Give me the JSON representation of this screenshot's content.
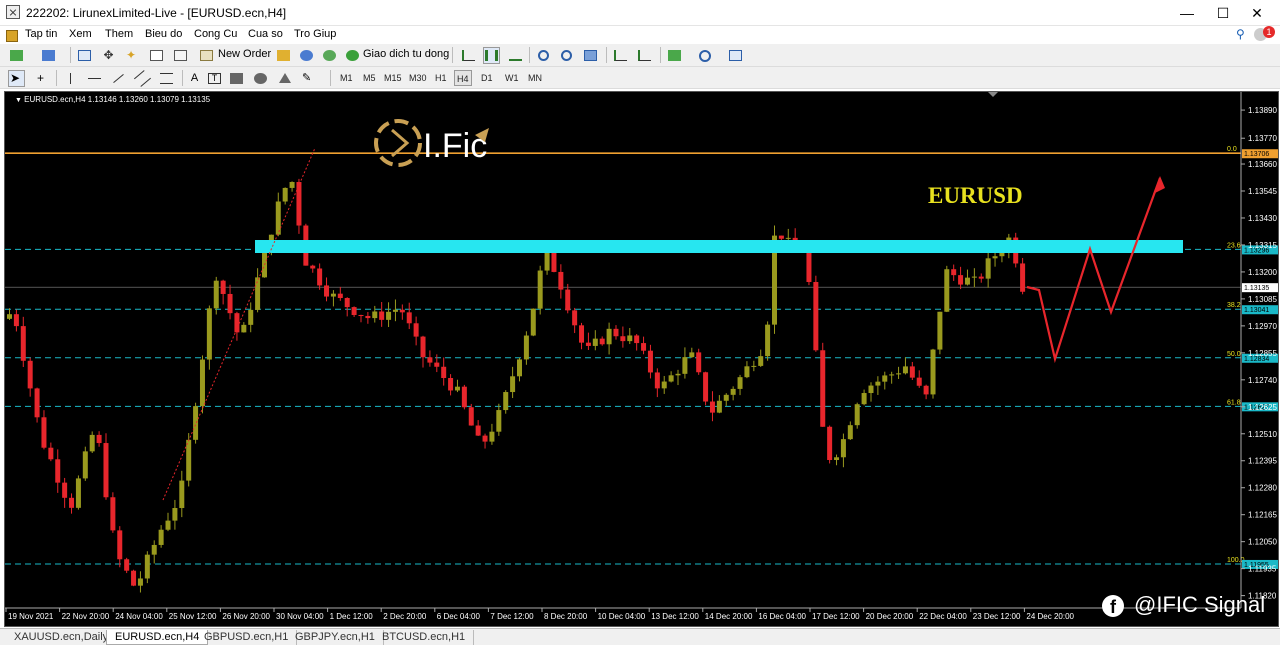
{
  "window": {
    "title": "222202: LirunexLimited-Live - [EURUSD.ecn,H4]",
    "minimize": "—",
    "maximize": "☐",
    "close": "✕"
  },
  "menu": {
    "items": [
      "Tap tin",
      "Xem",
      "Them",
      "Bieu do",
      "Cong Cu",
      "Cua so",
      "Tro Giup"
    ],
    "mdi": [
      "_",
      "🗗",
      "✕"
    ],
    "badge": "1"
  },
  "toolbar": {
    "new_order": "New Order",
    "auto_trading": "Giao dich tu dong",
    "icons": [
      "new-chart-icon",
      "profiles-icon",
      "market-watch-icon",
      "navigator-icon",
      "data-window-icon",
      "terminal-icon",
      "tester-icon",
      "metaeditor-icon",
      "gold-bar-icon",
      "signals-icon",
      "zoom-in-icon",
      "zoom-out-icon",
      "tile-icon",
      "bar-chart-icon",
      "candle-chart-icon",
      "line-chart-icon",
      "indicators-icon",
      "periods-icon",
      "templates-icon"
    ]
  },
  "drawing": {
    "periods": [
      "M1",
      "M5",
      "M15",
      "M30",
      "H1",
      "H4",
      "D1",
      "W1",
      "MN"
    ],
    "active_period": "H4"
  },
  "chart": {
    "symbol_info": "EURUSD.ecn,H4  1.13146 1.13260 1.13079 1.13135",
    "annotation": "EURUSD",
    "watermark": "@IFIC Signal",
    "logo_text": "I.Fic",
    "colors": {
      "bull": "#9a9a1e",
      "bear": "#e8262c",
      "zone": "#27e6f0",
      "arrow": "#e8262c",
      "ask_line": "#f0a030",
      "fib_line": "#1ab9c8"
    },
    "price_axis": [
      "1.13890",
      "1.13770",
      "1.13660",
      "1.13545",
      "1.13430",
      "1.13315",
      "1.13200",
      "1.13085",
      "1.12970",
      "1.12855",
      "1.12740",
      "1.12625",
      "1.12510",
      "1.12395",
      "1.12280",
      "1.12165",
      "1.12050",
      "1.11935",
      "1.11820"
    ],
    "time_axis": [
      "19 Nov 2021",
      "22 Nov 20:00",
      "24 Nov 04:00",
      "25 Nov 12:00",
      "26 Nov 20:00",
      "30 Nov 04:00",
      "1 Dec 12:00",
      "2 Dec 20:00",
      "6 Dec 04:00",
      "7 Dec 12:00",
      "8 Dec 20:00",
      "10 Dec 04:00",
      "13 Dec 12:00",
      "14 Dec 20:00",
      "16 Dec 04:00",
      "17 Dec 12:00",
      "20 Dec 20:00",
      "22 Dec 04:00",
      "23 Dec 12:00",
      "24 Dec 20:00"
    ],
    "fib_levels": [
      {
        "label": "0.0",
        "price": "1.13706"
      },
      {
        "label": "23.6",
        "price": "1.13296"
      },
      {
        "label": "38.2",
        "price": "1.13041"
      },
      {
        "label": "50.0",
        "price": "1.12834"
      },
      {
        "label": "61.8",
        "price": "1.12627"
      },
      {
        "label": "100.0",
        "price": "1.11955"
      }
    ],
    "current_price": "1.13135",
    "price_range": [
      1.1178,
      1.1395
    ]
  },
  "tabs": [
    "XAUUSD.ecn,Daily",
    "EURUSD.ecn,H4",
    "GBPUSD.ecn,H1",
    "GBPJPY.ecn,H1",
    "BTCUSD.ecn,H1"
  ],
  "active_tab": "EURUSD.ecn,H4"
}
